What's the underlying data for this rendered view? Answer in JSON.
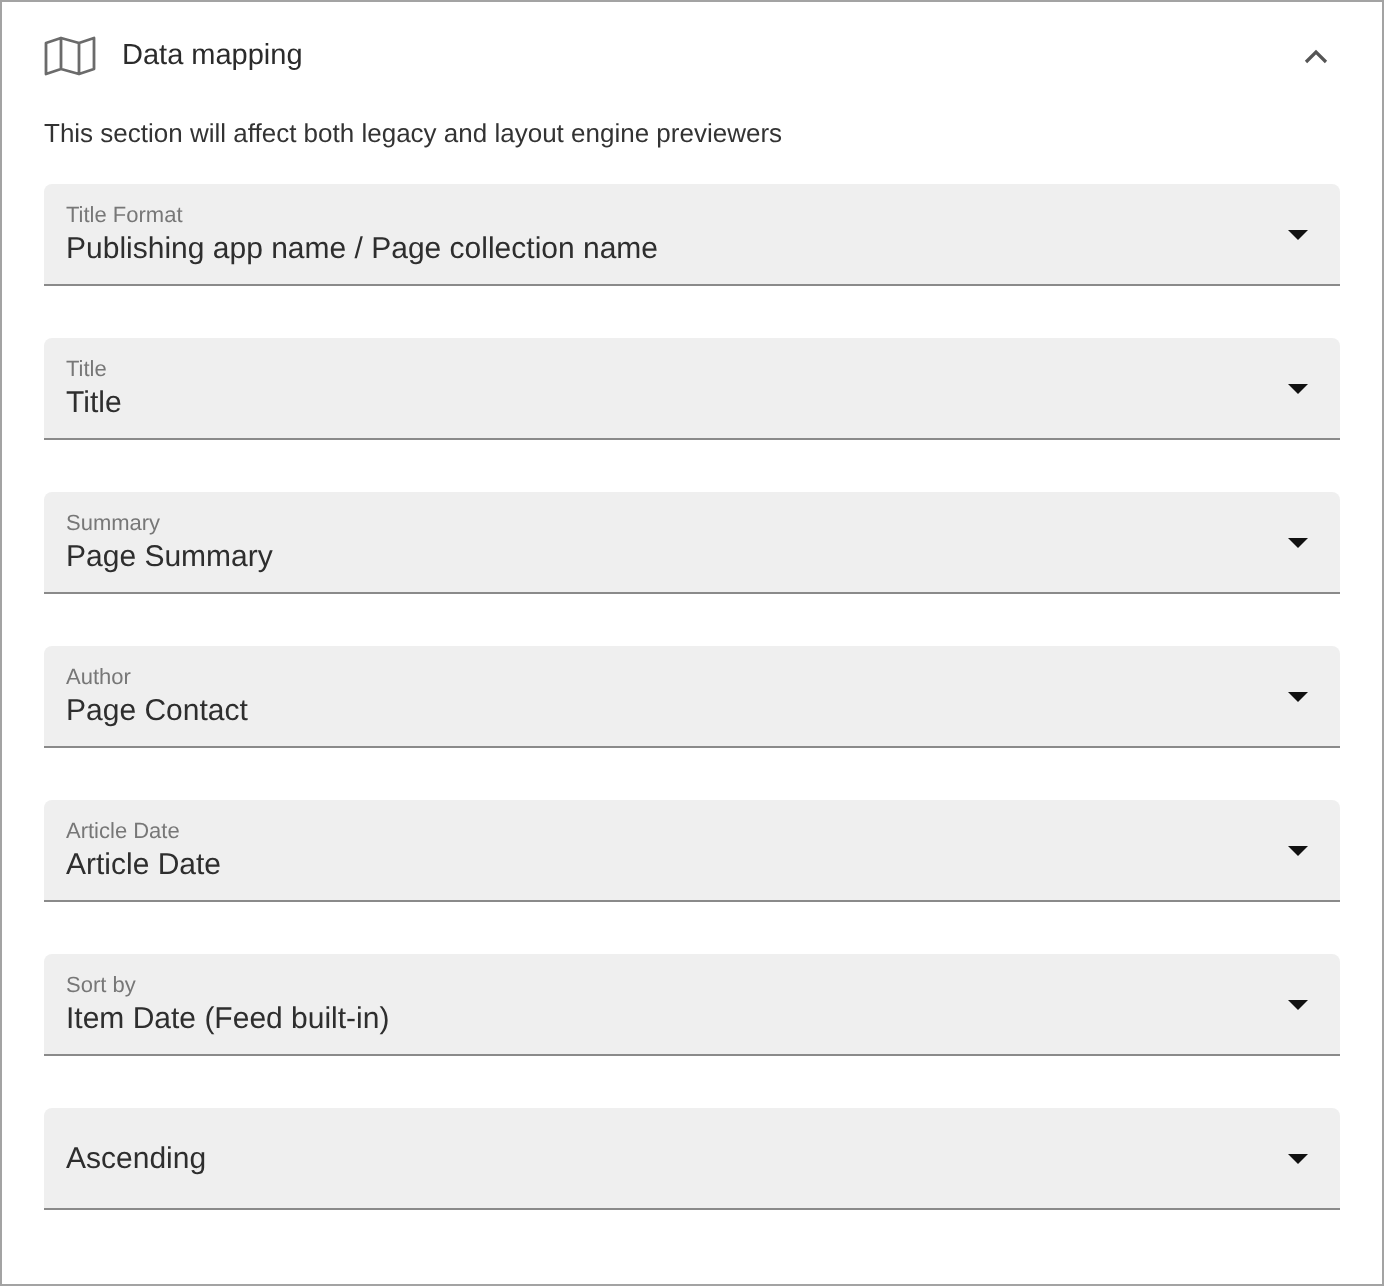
{
  "section": {
    "title": "Data mapping",
    "expanded": true,
    "description": "This section will affect both legacy and layout engine previewers"
  },
  "fields": [
    {
      "label": "Title Format",
      "value": "Publishing app name / Page collection name"
    },
    {
      "label": "Title",
      "value": "Title"
    },
    {
      "label": "Summary",
      "value": "Page Summary"
    },
    {
      "label": "Author",
      "value": "Page Contact"
    },
    {
      "label": "Article Date",
      "value": "Article Date"
    },
    {
      "label": "Sort by",
      "value": "Item Date (Feed built-in)"
    },
    {
      "value": "Ascending"
    }
  ]
}
